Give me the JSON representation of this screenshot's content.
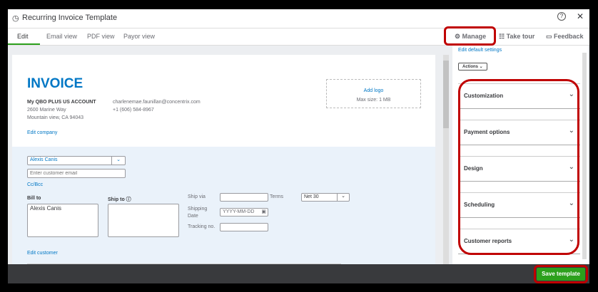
{
  "window": {
    "title": "Recurring Invoice Template"
  },
  "tabs": [
    {
      "label": "Edit"
    },
    {
      "label": "Email view"
    },
    {
      "label": "PDF view"
    },
    {
      "label": "Payor view"
    }
  ],
  "toolbar": {
    "manage": "Manage",
    "take_tour": "Take tour",
    "feedback": "Feedback"
  },
  "invoice": {
    "title": "INVOICE",
    "company_name": "My QBO PLUS US ACCOUNT",
    "address1": "2600 Marine Way",
    "address2": "Mountain view, CA 94043",
    "email": "charlenemae.faunillan@concentrix.com",
    "phone": "+1 (606) 584-8967",
    "edit_company": "Edit company",
    "add_logo": "Add logo",
    "max_size": "Max size: 1 MB"
  },
  "customer": {
    "name": "Alexis Canis",
    "email_placeholder": "Enter customer email",
    "cc_bcc": "Cc/Bcc",
    "bill_to_label": "Bill to",
    "bill_to_value": "Alexis Canis",
    "ship_to_label": "Ship to",
    "ship_via_label": "Ship via",
    "shipping_date_label": "Shipping Date",
    "shipping_date_placeholder": "YYYY-MM-DD",
    "tracking_label": "Tracking no.",
    "terms_label": "Terms",
    "terms_value": "Net 30",
    "edit_customer": "Edit customer"
  },
  "panel": {
    "edit_default": "Edit default settings",
    "actions": "Actions",
    "sections": [
      "Customization",
      "Payment options",
      "Design",
      "Scheduling",
      "Customer reports"
    ]
  },
  "footer": {
    "save": "Save template"
  }
}
